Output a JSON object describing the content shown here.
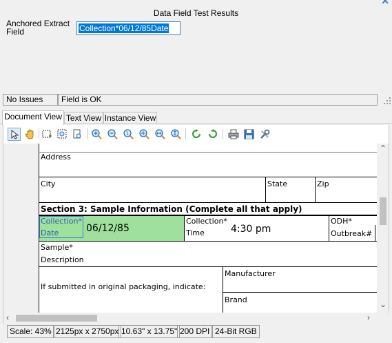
{
  "header": {
    "title": "Data Field Test Results",
    "field_label": "Anchored Extract Field",
    "field_value": "Collection*06/12/85Date"
  },
  "status": {
    "issues": "No Issues",
    "message": "Field is OK"
  },
  "tabs": [
    "Document View",
    "Text View",
    "Instance View"
  ],
  "toolbar": {
    "tools": [
      "select-tool",
      "pan-tool",
      "region-tool",
      "zoom-region-tool",
      "zoom-fit-tool",
      "zoom-in-tool",
      "zoom-out-tool",
      "zoom-actual-tool",
      "zoom-fit-page-tool",
      "zoom-fit-width-tool",
      "zoom-fit-height-tool",
      "rotate-clockwise-tool",
      "rotate-counterclockwise-tool",
      "print-tool",
      "save-tool",
      "settings-tool"
    ]
  },
  "document": {
    "address_label": "Address",
    "city_label": "City",
    "state_label": "State",
    "zip_label": "Zip",
    "section3_title": "Section 3:  Sample Information (Complete all that apply)",
    "collection_date_label_1": "Collection*",
    "collection_date_label_2": "Date",
    "collection_date_value": "06/12/85",
    "collection_time_label_1": "Collection*",
    "collection_time_label_2": "Time",
    "collection_time_value": "4:30 pm",
    "odh_label_1": "ODH*",
    "odh_label_2": "Outbreak#",
    "sample_label_1": "Sample*",
    "sample_label_2": "Description",
    "packaging_label": "If submitted in original packaging, indicate:",
    "manufacturer_label": "Manufacturer",
    "brand_label": "Brand"
  },
  "info_bar": {
    "scale": "Scale: 43%",
    "pixels": "2125px x 2750px",
    "inches": "10.63\" x 13.75\"",
    "dpi": "200 DPI",
    "color": "24-Bit RGB"
  },
  "colors": {
    "highlight_green": "#9ee09c",
    "selection_blue": "#0078d7"
  }
}
